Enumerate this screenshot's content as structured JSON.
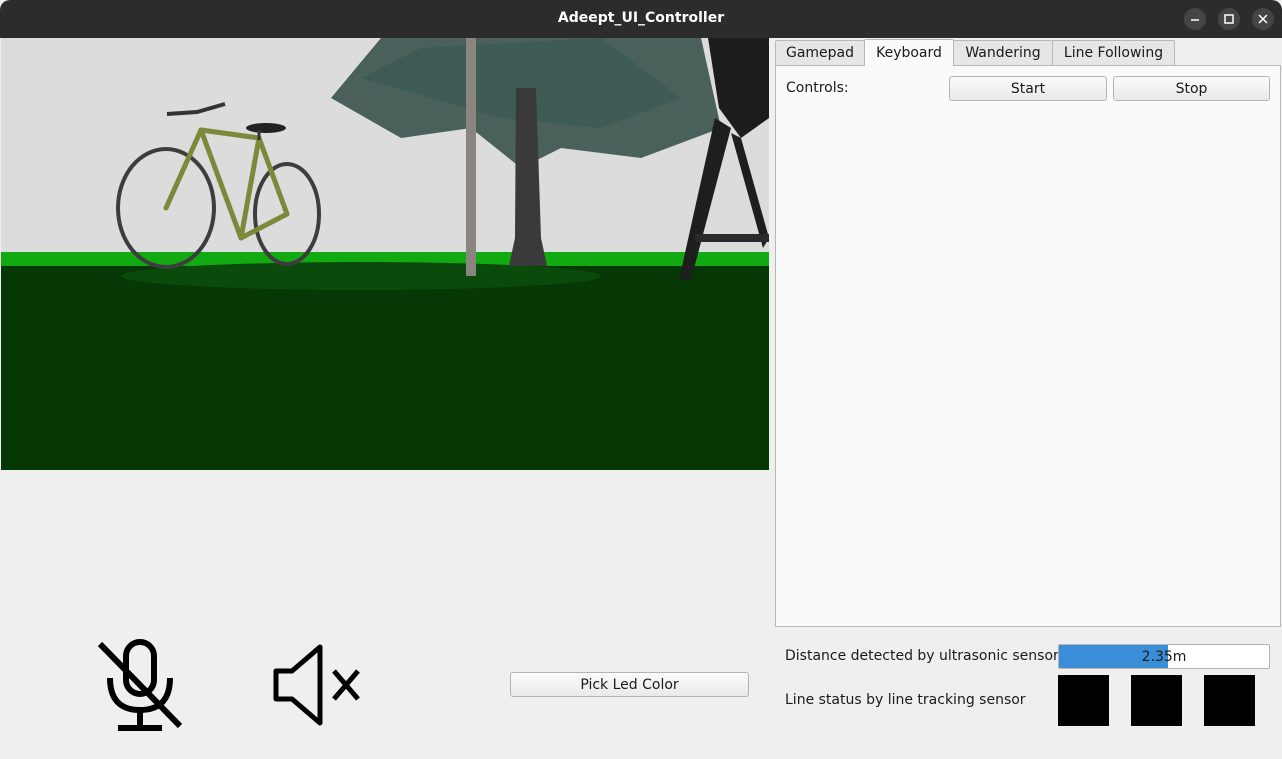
{
  "window": {
    "title": "Adeept_UI_Controller",
    "controls": {
      "minimize_icon": "minimize-icon",
      "maximize_icon": "maximize-icon",
      "close_icon": "close-icon"
    }
  },
  "camera_view": {
    "description_icon": "camera-feed"
  },
  "tabs": [
    {
      "label": "Gamepad",
      "active": false
    },
    {
      "label": "Keyboard",
      "active": true
    },
    {
      "label": "Wandering",
      "active": false
    },
    {
      "label": "Line Following",
      "active": false
    }
  ],
  "keyboard_panel": {
    "controls_label": "Controls:",
    "start_label": "Start",
    "stop_label": "Stop"
  },
  "sensors": {
    "distance_label": "Distance detected by ultrasonic sensor:",
    "distance_value": "2.35m",
    "distance_fraction": 0.52,
    "line_status_label": "Line status by line tracking sensor",
    "line_sensors": [
      "#000000",
      "#000000",
      "#000000"
    ]
  },
  "bottom_controls": {
    "mic_icon": "mic-muted-icon",
    "speaker_icon": "speaker-muted-icon",
    "pick_led_label": "Pick Led Color"
  },
  "colors": {
    "progress": "#3a8ed8",
    "titlebar": "#2c2c2c",
    "grass": "#0b3d0b"
  }
}
